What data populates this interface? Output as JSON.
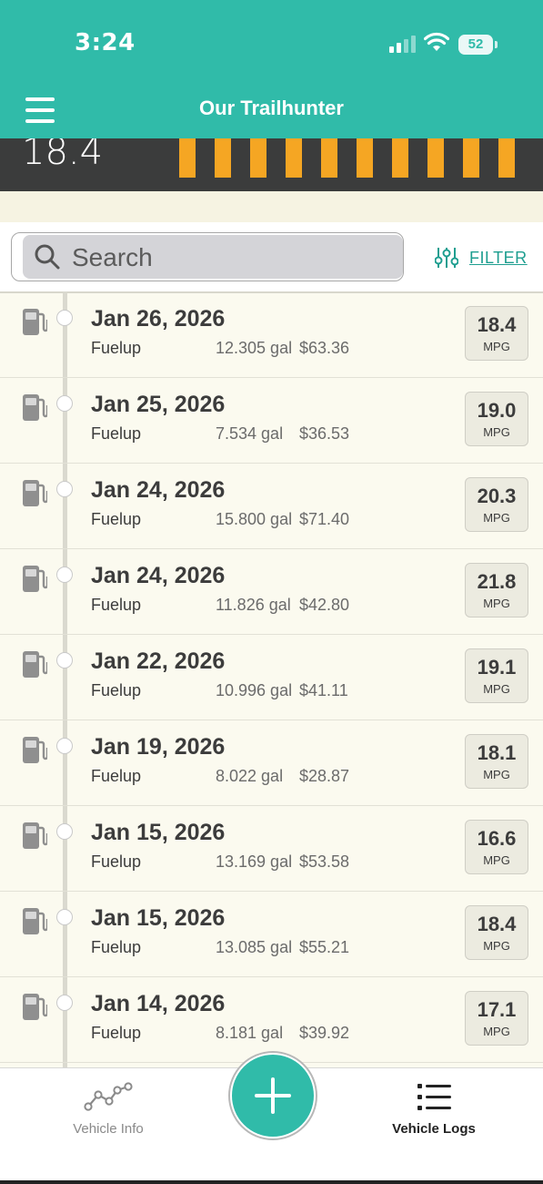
{
  "status_bar": {
    "time": "3:24",
    "battery": "52"
  },
  "nav": {
    "title": "Our Trailhunter"
  },
  "summary": {
    "value": "18.4"
  },
  "search": {
    "placeholder": "Search"
  },
  "filter": {
    "label": "FILTER"
  },
  "mpg_unit": "MPG",
  "logs": [
    {
      "date": "Jan 26, 2026",
      "type": "Fuelup",
      "gallons": "12.305 gal",
      "cost": "$63.36",
      "mpg": "18.4"
    },
    {
      "date": "Jan 25, 2026",
      "type": "Fuelup",
      "gallons": "7.534 gal",
      "cost": "$36.53",
      "mpg": "19.0"
    },
    {
      "date": "Jan 24, 2026",
      "type": "Fuelup",
      "gallons": "15.800 gal",
      "cost": "$71.40",
      "mpg": "20.3"
    },
    {
      "date": "Jan 24, 2026",
      "type": "Fuelup",
      "gallons": "11.826 gal",
      "cost": "$42.80",
      "mpg": "21.8"
    },
    {
      "date": "Jan 22, 2026",
      "type": "Fuelup",
      "gallons": "10.996 gal",
      "cost": "$41.11",
      "mpg": "19.1"
    },
    {
      "date": "Jan 19, 2026",
      "type": "Fuelup",
      "gallons": "8.022 gal",
      "cost": "$28.87",
      "mpg": "18.1"
    },
    {
      "date": "Jan 15, 2026",
      "type": "Fuelup",
      "gallons": "13.169 gal",
      "cost": "$53.58",
      "mpg": "16.6"
    },
    {
      "date": "Jan 15, 2026",
      "type": "Fuelup",
      "gallons": "13.085 gal",
      "cost": "$55.21",
      "mpg": "18.4"
    },
    {
      "date": "Jan 14, 2026",
      "type": "Fuelup",
      "gallons": "8.181 gal",
      "cost": "$39.92",
      "mpg": "17.1"
    }
  ],
  "tabs": [
    {
      "label": "Vehicle Info",
      "icon": "line-chart-icon"
    },
    {
      "label": "Vehicle Logs",
      "icon": "list-icon",
      "active": true
    }
  ],
  "colors": {
    "accent": "#30bba9",
    "stripe": "#f5a623",
    "dark_band": "#3b3c3c",
    "background": "#fbfaef"
  }
}
